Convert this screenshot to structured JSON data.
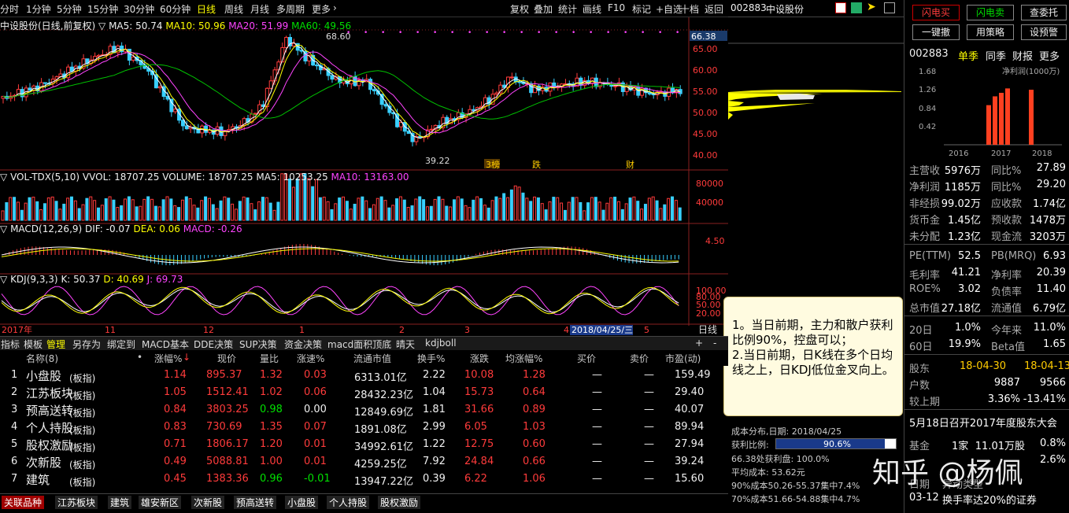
{
  "toolbar": {
    "periods": [
      "分时",
      "1分钟",
      "5分钟",
      "15分钟",
      "30分钟",
      "60分钟",
      "日线",
      "周线",
      "月线",
      "多周期",
      "更多"
    ],
    "tools": [
      "复权",
      "叠加",
      "统计",
      "画线",
      "F10",
      "标记",
      "+自选",
      "十档",
      "返回"
    ]
  },
  "stock": {
    "code": "002883",
    "name": "中设股份"
  },
  "kline": {
    "title": "中设股份(日线,前复权)",
    "ma5": "MA5: 50.74",
    "ma10": "MA10: 50.96",
    "ma20": "MA20: 51.99",
    "ma60": "MA60: 49.56",
    "price_ticks": [
      "65.00",
      "60.00",
      "55.00",
      "50.00",
      "45.00",
      "40.00"
    ],
    "current_price_label": "66.38",
    "high_label": "68.60",
    "low_label": "39.22",
    "events": [
      "3榜",
      "跌",
      "财"
    ]
  },
  "volume": {
    "title": "VOL-TDX(5,10)",
    "vvol": "VVOL: 18707.25",
    "volume": "VOLUME: 18707.25",
    "ma5": "MA5: 10253.25",
    "ma10": "MA10: 13163.00",
    "ticks": [
      "80000",
      "40000"
    ]
  },
  "macd": {
    "title": "MACD(12,26,9)",
    "dif": "DIF: -0.07",
    "dea": "DEA: 0.06",
    "macd": "MACD: -0.26",
    "tick": "4.50"
  },
  "kdj": {
    "title": "KDJ(9,3,3)",
    "k": "K: 50.37",
    "d": "D: 40.69",
    "j": "J: 69.73",
    "ticks": [
      "100.00",
      "80.00",
      "50.00",
      "20.00"
    ]
  },
  "date_axis": {
    "labels": [
      "2017年",
      "11",
      "12",
      "1",
      "2",
      "3",
      "4",
      "5"
    ],
    "cursor": "2018/04/25/三",
    "period_btn": "日线"
  },
  "tabs": [
    "指标",
    "模板",
    "管理",
    "另存为",
    "绑定到",
    "MACD基本",
    "DDE决策",
    "SUP决策",
    "资金决策",
    "macd面积顶底",
    "晴天",
    "kdjboll"
  ],
  "table": {
    "headers": [
      "名称(8)",
      "涨幅%",
      "现价",
      "量比",
      "涨速%",
      "流通市值",
      "换手%",
      "涨跌",
      "均涨幅%",
      "买价",
      "卖价",
      "市盈(动)"
    ],
    "rows": [
      {
        "idx": "1",
        "name": "小盘股",
        "tag": "(板指)",
        "chg": "1.14",
        "price": "895.37",
        "vr": "1.32",
        "speed": "0.03",
        "mcap": "6313.01亿",
        "turn": "2.22",
        "diff": "10.08",
        "avg": "1.28",
        "bid": "—",
        "ask": "—",
        "pe": "159.49"
      },
      {
        "idx": "2",
        "name": "江苏板块",
        "tag": "(板指)",
        "chg": "1.05",
        "price": "1512.41",
        "vr": "1.02",
        "speed": "0.06",
        "mcap": "28432.23亿",
        "turn": "1.04",
        "diff": "15.73",
        "avg": "0.64",
        "bid": "—",
        "ask": "—",
        "pe": "29.40"
      },
      {
        "idx": "3",
        "name": "预高送转",
        "tag": "(板指)",
        "chg": "0.84",
        "price": "3803.25",
        "vr": "0.98",
        "speed": "0.00",
        "mcap": "12849.69亿",
        "turn": "1.81",
        "diff": "31.66",
        "avg": "0.89",
        "bid": "—",
        "ask": "—",
        "pe": "40.07"
      },
      {
        "idx": "4",
        "name": "个人持股",
        "tag": "(板指)",
        "chg": "0.83",
        "price": "730.69",
        "vr": "1.35",
        "speed": "0.07",
        "mcap": "1891.08亿",
        "turn": "2.99",
        "diff": "6.05",
        "avg": "1.03",
        "bid": "—",
        "ask": "—",
        "pe": "89.94"
      },
      {
        "idx": "5",
        "name": "股权激励",
        "tag": "(板指)",
        "chg": "0.71",
        "price": "1806.17",
        "vr": "1.20",
        "speed": "0.01",
        "mcap": "34992.61亿",
        "turn": "1.22",
        "diff": "12.75",
        "avg": "0.60",
        "bid": "—",
        "ask": "—",
        "pe": "27.94"
      },
      {
        "idx": "6",
        "name": "次新股",
        "tag": "(板指)",
        "chg": "0.49",
        "price": "5088.81",
        "vr": "1.00",
        "speed": "0.01",
        "mcap": "4259.25亿",
        "turn": "7.92",
        "diff": "24.84",
        "avg": "0.66",
        "bid": "—",
        "ask": "—",
        "pe": "39.24"
      },
      {
        "idx": "7",
        "name": "建筑",
        "tag": "(板指)",
        "chg": "0.45",
        "price": "1383.36",
        "vr": "0.96",
        "speed": "-0.01",
        "mcap": "13947.22亿",
        "turn": "0.39",
        "diff": "6.22",
        "avg": "1.06",
        "bid": "—",
        "ask": "—",
        "pe": "15.60"
      }
    ]
  },
  "bottom_tabs": [
    "关联品种",
    "江苏板块",
    "建筑",
    "雄安新区",
    "次新股",
    "预高送转",
    "小盘股",
    "个人持股",
    "股权激励"
  ],
  "callout": {
    "line1": "1。当日前期，主力和散户获利比例90%，控盘可以；",
    "line2": "2.当日前期，日K线在多个日均线之上，日KDJ低位金叉向上。"
  },
  "cost": {
    "title": "成本分布,日期: 2018/04/25",
    "profit_label": "获利比例:",
    "profit_value": "90.6%",
    "profit_ratio": 0.906,
    "line1": "66.38处获利盘: 100.0%",
    "line2": "平均成本: 53.62元",
    "line3": "90%成本50.26-55.37集中7.4%",
    "line4": "70%成本51.66-54.88集中4.7%"
  },
  "right": {
    "buttons": [
      "闪电买",
      "闪电卖",
      "查委托",
      "一键撤",
      "用策略",
      "设预警"
    ],
    "code": "002883",
    "fin_tabs": [
      "单季",
      "同季",
      "财报",
      "更多"
    ],
    "bar_title": "净利润(1000万)",
    "bar_ticks": [
      "1.68",
      "1.26",
      "0.84",
      "0.42"
    ],
    "bar_years": [
      "2016",
      "2017",
      "2018"
    ],
    "bar_values": [
      0.9,
      1.1,
      1.18,
      1.28,
      1.25
    ],
    "fin_rows": [
      {
        "l1": "主营收",
        "v1": "5976万",
        "l2": "同比%",
        "v2": "27.89"
      },
      {
        "l1": "净利润",
        "v1": "1185万",
        "l2": "同比%",
        "v2": "29.20"
      },
      {
        "l1": "非经损",
        "v1": "99.02万",
        "l2": "应收款",
        "v2": "1.74亿"
      },
      {
        "l1": "货币金",
        "v1": "1.45亿",
        "l2": "预收款",
        "v2": "1478万"
      },
      {
        "l1": "未分配",
        "v1": "1.23亿",
        "l2": "现金流",
        "v2": "3203万"
      }
    ],
    "val_rows": [
      {
        "l1": "PE(TTM)",
        "v1": "52.5",
        "l2": "PB(MRQ)",
        "v2": "6.93"
      },
      {
        "l1": "毛利率",
        "v1": "41.21",
        "l2": "净利率",
        "v2": "20.39"
      },
      {
        "l1": "ROE%",
        "v1": "3.02",
        "l2": "负债率",
        "v2": "11.40"
      },
      {
        "l1": "总市值",
        "v1": "27.18亿",
        "l2": "流通值",
        "v2": "6.79亿"
      }
    ],
    "perf_rows": [
      {
        "l1": "20日",
        "v1": "1.0%",
        "l2": "今年来",
        "v2": "11.0%"
      },
      {
        "l1": "60日",
        "v1": "19.9%",
        "l2": "Beta值",
        "v2": "1.65"
      }
    ],
    "holders": {
      "label": "股东",
      "d1": "18-04-30",
      "d2": "18-04-13",
      "r1l": "户数",
      "r1a": "9887",
      "r1b": "9566",
      "r2l": "较上期",
      "r2a": "3.36%",
      "r2b": "-13.41%"
    },
    "notice": "5月18日召开2017年度股东大会",
    "fund": {
      "label": "基金",
      "v1": "1家",
      "v2": "11.01万股",
      "v3": "0.8%"
    },
    "fund2": "2.6%",
    "date_label": "日期",
    "type_label": "异动类型",
    "event_date": "03-12",
    "event_text": "换手率达20%的证券"
  },
  "watermark": "知乎 @杨佩"
}
